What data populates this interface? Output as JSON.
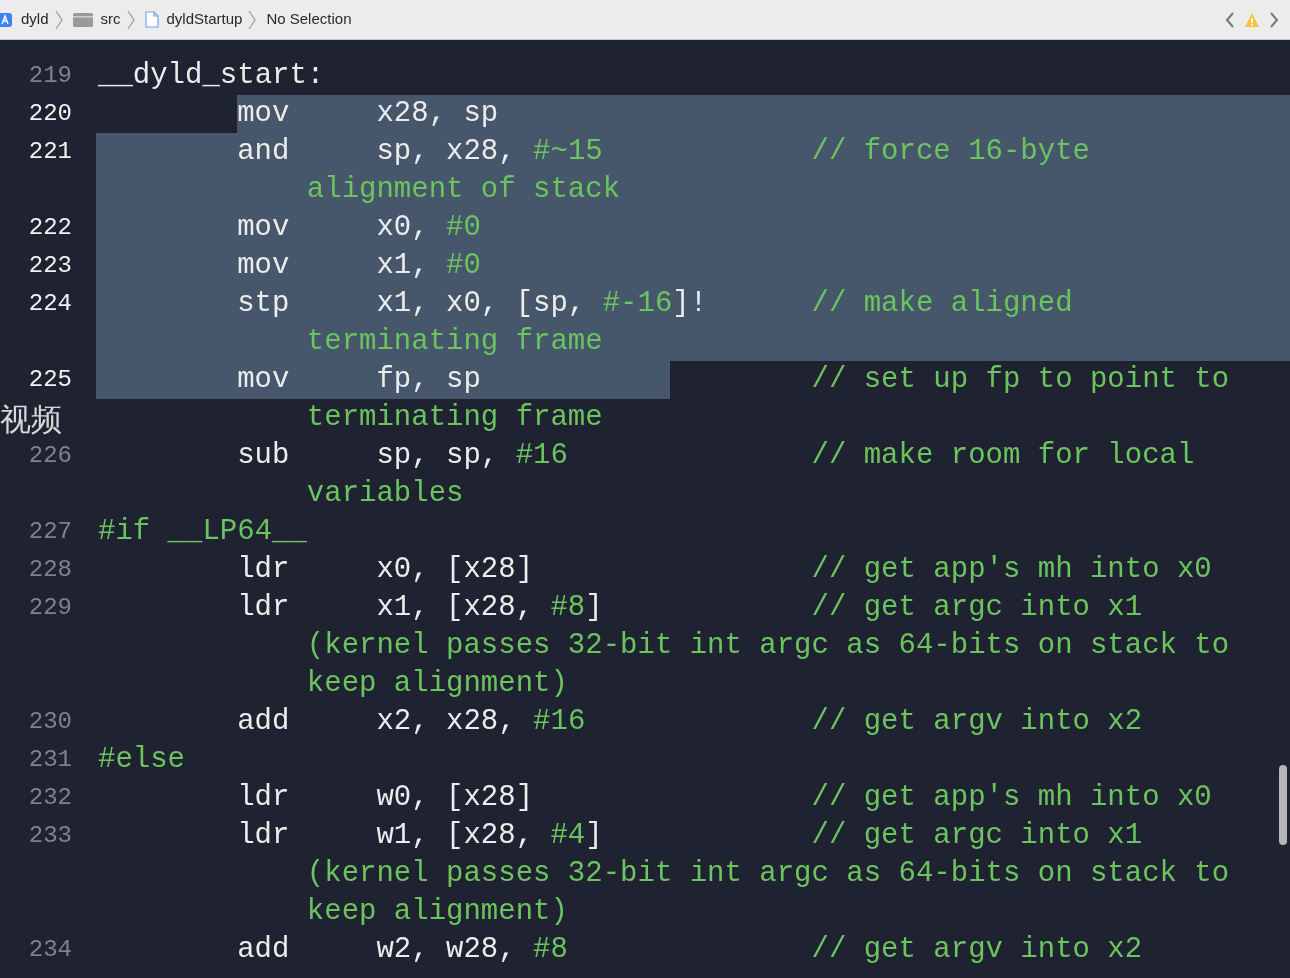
{
  "breadcrumbs": [
    {
      "label": "dyld",
      "kind": "app"
    },
    {
      "label": "src",
      "kind": "folder"
    },
    {
      "label": "dyldStartup",
      "kind": "file"
    },
    {
      "label": "No Selection",
      "kind": "none"
    }
  ],
  "overlay_label": "视频",
  "lines": [
    {
      "number": "219",
      "selected": false,
      "kind": "label",
      "label": "__dyld_start:"
    },
    {
      "number": "220",
      "selected": true,
      "kind": "instruction",
      "mnemonic": "mov",
      "operands": [
        {
          "text": "x28, sp",
          "kind": "plain"
        }
      ]
    },
    {
      "number": "221",
      "selected": true,
      "kind": "instruction",
      "mnemonic": "and",
      "operands": [
        {
          "text": "sp, x28, ",
          "kind": "plain"
        },
        {
          "text": "#~15",
          "kind": "literal"
        }
      ],
      "comment": "// force 16-byte",
      "wrap": "alignment of stack"
    },
    {
      "number": "222",
      "selected": true,
      "kind": "instruction",
      "mnemonic": "mov",
      "operands": [
        {
          "text": "x0, ",
          "kind": "plain"
        },
        {
          "text": "#0",
          "kind": "literal"
        }
      ]
    },
    {
      "number": "223",
      "selected": true,
      "kind": "instruction",
      "mnemonic": "mov",
      "operands": [
        {
          "text": "x1, ",
          "kind": "plain"
        },
        {
          "text": "#0",
          "kind": "literal"
        }
      ]
    },
    {
      "number": "224",
      "selected": true,
      "kind": "instruction",
      "mnemonic": "stp",
      "operands": [
        {
          "text": "x1, x0, [sp, ",
          "kind": "plain"
        },
        {
          "text": "#-16",
          "kind": "literal"
        },
        {
          "text": "]!",
          "kind": "plain"
        }
      ],
      "comment": "// make aligned",
      "wrap": "terminating frame"
    },
    {
      "number": "225",
      "selected": true,
      "kind": "instruction",
      "mnemonic": "mov",
      "operands": [
        {
          "text": "fp, sp",
          "kind": "plain"
        }
      ],
      "comment": "// set up fp to point to",
      "wrap": "terminating frame"
    },
    {
      "number": "226",
      "selected": false,
      "kind": "instruction",
      "mnemonic": "sub",
      "operands": [
        {
          "text": "sp, sp, ",
          "kind": "plain"
        },
        {
          "text": "#16",
          "kind": "literal"
        }
      ],
      "comment": "// make room for local",
      "wrap": "variables"
    },
    {
      "number": "227",
      "selected": false,
      "kind": "directive",
      "label": "#if __LP64__"
    },
    {
      "number": "228",
      "selected": false,
      "kind": "instruction",
      "mnemonic": "ldr",
      "operands": [
        {
          "text": "x0, [x28]",
          "kind": "plain"
        }
      ],
      "comment": "// get app's mh into x0"
    },
    {
      "number": "229",
      "selected": false,
      "kind": "instruction",
      "mnemonic": "ldr",
      "operands": [
        {
          "text": "x1, [x28, ",
          "kind": "plain"
        },
        {
          "text": "#8",
          "kind": "literal"
        },
        {
          "text": "]",
          "kind": "plain"
        }
      ],
      "comment": "// get argc into x1",
      "wrap": "(kernel passes 32-bit int argc as 64-bits on stack to",
      "wrap2": "keep alignment)"
    },
    {
      "number": "230",
      "selected": false,
      "kind": "instruction",
      "mnemonic": "add",
      "operands": [
        {
          "text": "x2, x28, ",
          "kind": "plain"
        },
        {
          "text": "#16",
          "kind": "literal"
        }
      ],
      "comment": "// get argv into x2"
    },
    {
      "number": "231",
      "selected": false,
      "kind": "directive",
      "label": "#else"
    },
    {
      "number": "232",
      "selected": false,
      "kind": "instruction",
      "mnemonic": "ldr",
      "operands": [
        {
          "text": "w0, [x28]",
          "kind": "plain"
        }
      ],
      "comment": "// get app's mh into x0"
    },
    {
      "number": "233",
      "selected": false,
      "kind": "instruction",
      "mnemonic": "ldr",
      "operands": [
        {
          "text": "w1, [x28, ",
          "kind": "plain"
        },
        {
          "text": "#4",
          "kind": "literal"
        },
        {
          "text": "]",
          "kind": "plain"
        }
      ],
      "comment": "// get argc into x1",
      "wrap": "(kernel passes 32-bit int argc as 64-bits on stack to",
      "wrap2": "keep alignment)"
    },
    {
      "number": "234",
      "selected": false,
      "kind": "instruction",
      "mnemonic": "add",
      "operands": [
        {
          "text": "w2, w28, ",
          "kind": "plain"
        },
        {
          "text": "#8",
          "kind": "literal"
        }
      ],
      "comment": "// get argv into x2"
    }
  ]
}
